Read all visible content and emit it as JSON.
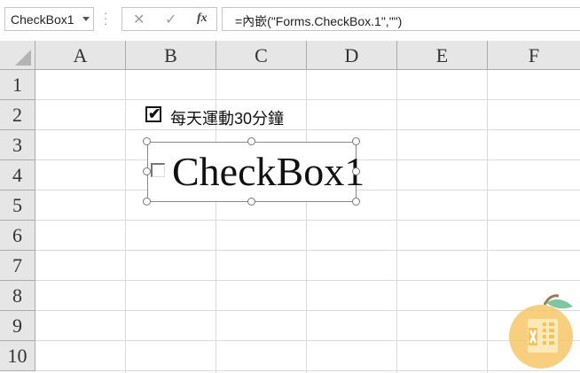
{
  "formula_bar": {
    "name_box": "CheckBox1",
    "cancel_icon": "cancel-icon",
    "enter_icon": "enter-icon",
    "function_label": "fx",
    "formula": "=內嵌(\"Forms.CheckBox.1\",\"\")"
  },
  "columns": [
    "A",
    "B",
    "C",
    "D",
    "E",
    "F"
  ],
  "rows": [
    "1",
    "2",
    "3",
    "4",
    "5",
    "6",
    "7",
    "8",
    "9",
    "10"
  ],
  "form_checkbox": {
    "checked": true,
    "label": "每天運動30分鐘"
  },
  "activex_checkbox": {
    "checked": false,
    "label": "CheckBox1"
  },
  "colors": {
    "header_bg": "#e6e6e6",
    "gridline": "#dadada",
    "logo_orange": "#f5c35e",
    "logo_leaf": "#7cc7a0"
  }
}
